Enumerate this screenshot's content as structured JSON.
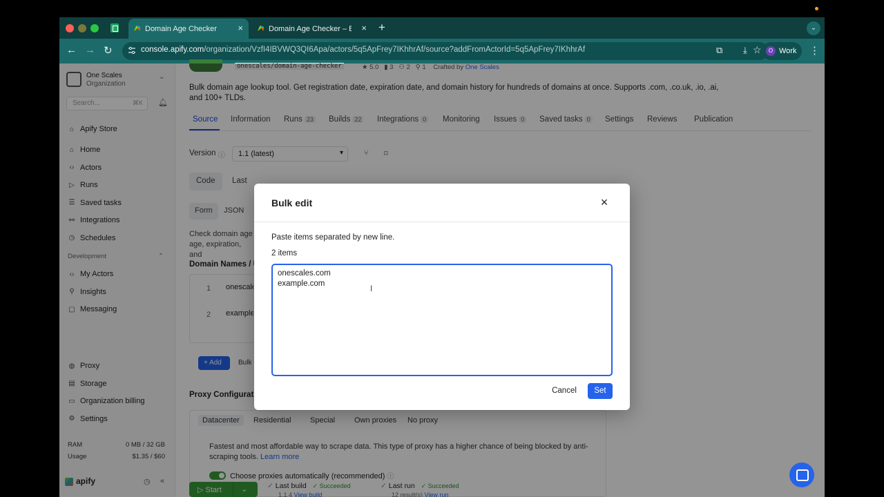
{
  "browser": {
    "tabs": [
      {
        "title": "Domain Age Checker",
        "active": true
      },
      {
        "title": "Domain Age Checker – Bulk W",
        "active": false
      }
    ],
    "url_main": "console.apify.com",
    "url_rest": "/organization/VzfI4IBVWQ3QI6Apa/actors/5q5ApFrey7IKhhrAf/source?addFromActorId=5q5ApFrey7IKhhrAf",
    "profile_initial": "O",
    "profile_name": "Work"
  },
  "sidebar": {
    "org_name": "One Scales",
    "org_type": "Organization",
    "search_placeholder": "Search...",
    "search_shortcut": "⌘K",
    "store_item": "Apify Store",
    "items": [
      {
        "label": "Home",
        "icon": "home-icon",
        "glyph": "⌂"
      },
      {
        "label": "Actors",
        "icon": "code-icon",
        "glyph": "‹›"
      },
      {
        "label": "Runs",
        "icon": "play-icon",
        "glyph": "▷"
      },
      {
        "label": "Saved tasks",
        "icon": "list-icon",
        "glyph": "☰"
      },
      {
        "label": "Integrations",
        "icon": "integrations-icon",
        "glyph": "⚯"
      },
      {
        "label": "Schedules",
        "icon": "clock-icon",
        "glyph": "◷"
      }
    ],
    "dev_section": "Development",
    "dev_items": [
      {
        "label": "My Actors",
        "icon": "code-icon",
        "glyph": "‹›"
      },
      {
        "label": "Insights",
        "icon": "insights-icon",
        "glyph": "⚲"
      },
      {
        "label": "Messaging",
        "icon": "message-icon",
        "glyph": "▢"
      }
    ],
    "bottom_items": [
      {
        "label": "Proxy",
        "icon": "globe-icon",
        "glyph": "◍"
      },
      {
        "label": "Storage",
        "icon": "database-icon",
        "glyph": "▤"
      },
      {
        "label": "Organization billing",
        "icon": "billing-icon",
        "glyph": "▭"
      },
      {
        "label": "Settings",
        "icon": "gear-icon",
        "glyph": "⚙"
      }
    ],
    "ram_label": "RAM",
    "ram_value": "0 MB / 32 GB",
    "usage_label": "Usage",
    "usage_value": "$1.35 / $60",
    "brand": "apify"
  },
  "actor": {
    "slug": "onescales/domain-age-checker",
    "rating": "★ 5.0",
    "stat1": "3",
    "stat2": "2",
    "stat3": "1",
    "crafted_label": "Crafted by",
    "crafted_by": "One Scales",
    "description": "Bulk domain age lookup tool. Get registration date, expiration date, and domain history for hundreds of domains at once. Supports .com, .co.uk, .io, .ai, and 100+ TLDs.",
    "tabs": [
      {
        "label": "Source",
        "count": ""
      },
      {
        "label": "Information",
        "count": ""
      },
      {
        "label": "Runs",
        "count": "23"
      },
      {
        "label": "Builds",
        "count": "22"
      },
      {
        "label": "Integrations",
        "count": "0"
      },
      {
        "label": "Monitoring",
        "count": ""
      },
      {
        "label": "Issues",
        "count": "0"
      },
      {
        "label": "Saved tasks",
        "count": "0"
      },
      {
        "label": "Settings",
        "count": ""
      },
      {
        "label": "Reviews",
        "count": ""
      },
      {
        "label": "Publication",
        "count": ""
      }
    ],
    "version_label": "Version",
    "version_value": "1.1 (latest)",
    "subtabs": [
      "Code",
      "Last"
    ],
    "formtabs": [
      "Form",
      "JSON"
    ],
    "help_text": "Check domain age age, expiration, and",
    "field_label": "Domain Names / U",
    "list_items": [
      {
        "n": "1",
        "v": "onescales.com"
      },
      {
        "n": "2",
        "v": "example.com"
      }
    ],
    "add_label": "+ Add",
    "bulk_label": "Bulk",
    "proxy_label": "Proxy Configuration",
    "proxy_types": [
      "Datacenter",
      "Residential",
      "Special",
      "Own proxies",
      "No proxy"
    ],
    "proxy_desc": "Fastest and most affordable way to scrape data. This type of proxy has a higher chance of being blocked by anti-scraping tools.",
    "proxy_learn": "Learn more",
    "toggle_label": "Choose proxies automatically (recommended)",
    "start_label": "Start",
    "last_build_label": "Last build",
    "last_build_status": "✓ Succeeded",
    "last_build_version": "1.1.4",
    "last_build_link": "View build",
    "last_run_label": "Last run",
    "last_run_status": "✓ Succeeded",
    "last_run_results": "12 result(s)",
    "last_run_link": "View run"
  },
  "modal": {
    "title": "Bulk edit",
    "help": "Paste items separated by new line.",
    "count": "2 items",
    "textarea_value": "onescales.com\nexample.com",
    "cancel_label": "Cancel",
    "set_label": "Set"
  }
}
